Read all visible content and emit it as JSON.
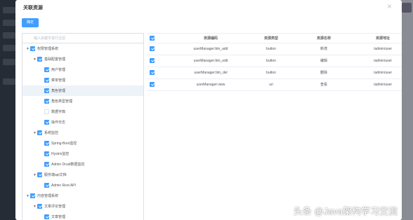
{
  "modal": {
    "title": "关联资源",
    "close_icon": "close-icon",
    "confirm_label": "确定"
  },
  "tree": {
    "filter_placeholder": "输入关键字进行过滤",
    "nodes": [
      {
        "label": "权限管理系统",
        "level": 0,
        "expanded": true,
        "checked": true
      },
      {
        "label": "基础配置管理",
        "level": 1,
        "expanded": true,
        "checked": true
      },
      {
        "label": "用户管理",
        "level": 2,
        "checked": true
      },
      {
        "label": "菜单管理",
        "level": 2,
        "checked": true
      },
      {
        "label": "角色管理",
        "level": 2,
        "checked": true,
        "highlighted": true
      },
      {
        "label": "角色类型管理",
        "level": 2,
        "checked": true
      },
      {
        "label": "数据字典",
        "level": 2,
        "checked": false
      },
      {
        "label": "操作日志",
        "level": 2,
        "checked": true
      },
      {
        "label": "系统监控",
        "level": 1,
        "expanded": true,
        "checked": true
      },
      {
        "label": "Spring-Boot监控",
        "level": 2,
        "checked": true
      },
      {
        "label": "Hystrix监控",
        "level": 2,
        "checked": true
      },
      {
        "label": "Admin Druid数据监控",
        "level": 2,
        "checked": true
      },
      {
        "label": "服务端api文档",
        "level": 1,
        "expanded": true,
        "checked": true
      },
      {
        "label": "Admin Rest API",
        "level": 2,
        "checked": true
      },
      {
        "label": "内容管理系统",
        "level": 0,
        "expanded": true,
        "checked": true
      },
      {
        "label": "文章评论管理",
        "level": 1,
        "expanded": true,
        "checked": true
      },
      {
        "label": "文章管理",
        "level": 2,
        "checked": true
      }
    ]
  },
  "table": {
    "header_checked": true,
    "columns": [
      "资源编码",
      "资源类型",
      "资源名称",
      "资源地址"
    ],
    "rows": [
      {
        "checked": true,
        "code": "userManager:btn_add",
        "type": "button",
        "name": "新增",
        "url": "/admin/user"
      },
      {
        "checked": true,
        "code": "userManager:btn_edit",
        "type": "button",
        "name": "编辑",
        "url": "/admin/user"
      },
      {
        "checked": true,
        "code": "userManager:btn_del",
        "type": "button",
        "name": "删除",
        "url": "/admin/user"
      },
      {
        "checked": true,
        "code": "userManager:view",
        "type": "uri",
        "name": "查看",
        "url": "/admin/user"
      }
    ]
  },
  "watermark": "头条 @Java架构学习交流",
  "colors": {
    "accent": "#409eff",
    "overlay": "#7d8087"
  }
}
